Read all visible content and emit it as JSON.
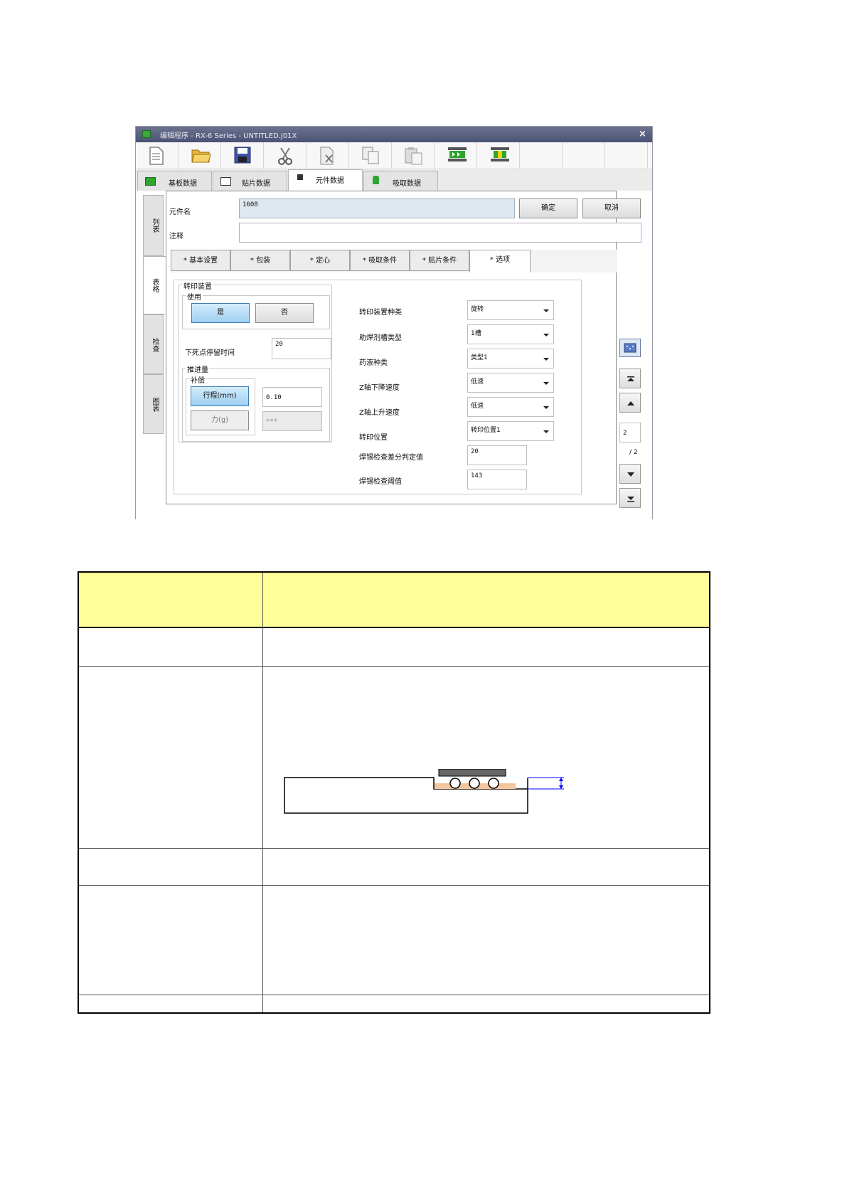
{
  "window": {
    "title": "编辑程序 - RX-6 Series - UNTITLED.J01X",
    "close_glyph": "×"
  },
  "toolbar": {
    "icons": [
      "new-file-icon",
      "open-folder-icon",
      "save-icon",
      "cut-icon",
      "delete-icon",
      "copy-icon",
      "paste-icon",
      "conveyor-icon",
      "board-icon"
    ]
  },
  "top_tabs": [
    "基板数据",
    "贴片数据",
    "元件数据",
    "吸取数据"
  ],
  "active_top_tab": "元件数据",
  "side_tabs": [
    "列表",
    "表格",
    "检查",
    "图表"
  ],
  "component": {
    "name_label": "元件名",
    "name_value": "1608",
    "comment_label": "注释",
    "comment_value": "",
    "ok_button": "确定",
    "cancel_button": "取消"
  },
  "sub_tabs": [
    "* 基本设置",
    "* 包装",
    "* 定心",
    "* 吸取条件",
    "* 贴片条件",
    "* 选项"
  ],
  "active_sub_tab": "* 选项",
  "transfer": {
    "group_label": "转印装置",
    "use_label": "使用",
    "yes_button": "是",
    "no_button": "否",
    "dwell_label": "下死点停留时间",
    "dwell_value": "20",
    "feed_label": "推进量",
    "comp_label": "补偿",
    "stroke_button": "行程(mm)",
    "force_button": "力(g)",
    "stroke_value": "0.10",
    "force_value": "***"
  },
  "fields": [
    {
      "label": "转印装置种类",
      "value": "旋转",
      "dropdown": true
    },
    {
      "label": "助焊剂槽类型",
      "value": "1槽",
      "dropdown": true
    },
    {
      "label": "药液种类",
      "value": "类型1",
      "dropdown": true
    },
    {
      "label": "Z轴下降速度",
      "value": "低速",
      "dropdown": true
    },
    {
      "label": "Z轴上升速度",
      "value": "低速",
      "dropdown": true
    },
    {
      "label": "转印位置",
      "value": "转印位置1",
      "dropdown": true
    },
    {
      "label": "焊锡检查差分判定值",
      "value": "20",
      "dropdown": false
    },
    {
      "label": "焊锡检查阈值",
      "value": "143",
      "dropdown": false
    }
  ],
  "pager": {
    "current": "2",
    "total": "/ 2"
  },
  "colors": {
    "titlebar": "#5a6080",
    "table_header": "#ffff99",
    "selected_button": "#a9d6f5",
    "diagram_arrow": "#0000ff",
    "flux_layer": "#f4c6a0"
  }
}
